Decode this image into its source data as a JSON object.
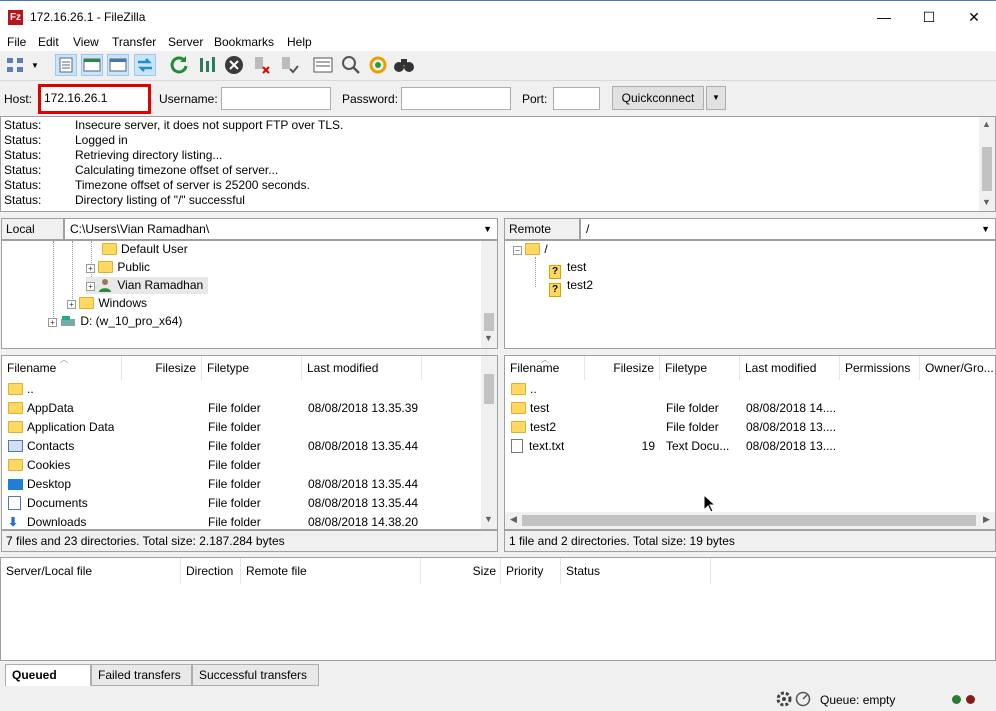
{
  "window": {
    "title": "172.16.26.1 - FileZilla",
    "app_icon_letter": "Fz",
    "minimize": "—",
    "maximize": "☐",
    "close": "✕"
  },
  "menu": [
    "File",
    "Edit",
    "View",
    "Transfer",
    "Server",
    "Bookmarks",
    "Help"
  ],
  "quickconnect": {
    "host_label": "Host:",
    "host_value": "172.16.26.1",
    "username_label": "Username:",
    "username_value": "",
    "password_label": "Password:",
    "password_value": "",
    "port_label": "Port:",
    "port_value": "",
    "button": "Quickconnect",
    "dropdown": "▼"
  },
  "log": [
    {
      "k": "Status:",
      "v": "Insecure server, it does not support FTP over TLS."
    },
    {
      "k": "Status:",
      "v": "Logged in"
    },
    {
      "k": "Status:",
      "v": "Retrieving directory listing..."
    },
    {
      "k": "Status:",
      "v": "Calculating timezone offset of server..."
    },
    {
      "k": "Status:",
      "v": "Timezone offset of server is 25200 seconds."
    },
    {
      "k": "Status:",
      "v": "Directory listing of \"/\" successful"
    }
  ],
  "local": {
    "site_label": "Local site:",
    "path": "C:\\Users\\Vian Ramadhan\\",
    "tree": [
      "Default User",
      "Public",
      "Vian Ramadhan",
      "Windows",
      "D: (w_10_pro_x64)"
    ],
    "columns": [
      "Filename",
      "Filesize",
      "Filetype",
      "Last modified"
    ],
    "files": [
      {
        "name": "..",
        "size": "",
        "type": "",
        "modified": "",
        "icon": "folder"
      },
      {
        "name": "AppData",
        "size": "",
        "type": "File folder",
        "modified": "08/08/2018 13.35.39",
        "icon": "folder"
      },
      {
        "name": "Application Data",
        "size": "",
        "type": "File folder",
        "modified": "",
        "icon": "folder"
      },
      {
        "name": "Contacts",
        "size": "",
        "type": "File folder",
        "modified": "08/08/2018 13.35.44",
        "icon": "contacts"
      },
      {
        "name": "Cookies",
        "size": "",
        "type": "File folder",
        "modified": "",
        "icon": "folder"
      },
      {
        "name": "Desktop",
        "size": "",
        "type": "File folder",
        "modified": "08/08/2018 13.35.44",
        "icon": "desktop"
      },
      {
        "name": "Documents",
        "size": "",
        "type": "File folder",
        "modified": "08/08/2018 13.35.44",
        "icon": "documents"
      },
      {
        "name": "Downloads",
        "size": "",
        "type": "File folder",
        "modified": "08/08/2018 14.38.20",
        "icon": "downloads"
      }
    ],
    "status": "7 files and 23 directories. Total size: 2.187.284 bytes"
  },
  "remote": {
    "site_label": "Remote site:",
    "path": "/",
    "tree": [
      "/",
      "test",
      "test2"
    ],
    "columns": [
      "Filename",
      "Filesize",
      "Filetype",
      "Last modified",
      "Permissions",
      "Owner/Gro..."
    ],
    "files": [
      {
        "name": "..",
        "size": "",
        "type": "",
        "modified": "",
        "icon": "folder"
      },
      {
        "name": "test",
        "size": "",
        "type": "File folder",
        "modified": "08/08/2018 14....",
        "icon": "folder"
      },
      {
        "name": "test2",
        "size": "",
        "type": "File folder",
        "modified": "08/08/2018 13....",
        "icon": "folder"
      },
      {
        "name": "text.txt",
        "size": "19",
        "type": "Text Docu...",
        "modified": "08/08/2018 13....",
        "icon": "file"
      }
    ],
    "status": "1 file and 2 directories. Total size: 19 bytes"
  },
  "queue": {
    "columns": [
      "Server/Local file",
      "Direction",
      "Remote file",
      "Size",
      "Priority",
      "Status"
    ],
    "tabs": [
      "Queued files",
      "Failed transfers",
      "Successful transfers"
    ],
    "status": "Queue: empty"
  }
}
